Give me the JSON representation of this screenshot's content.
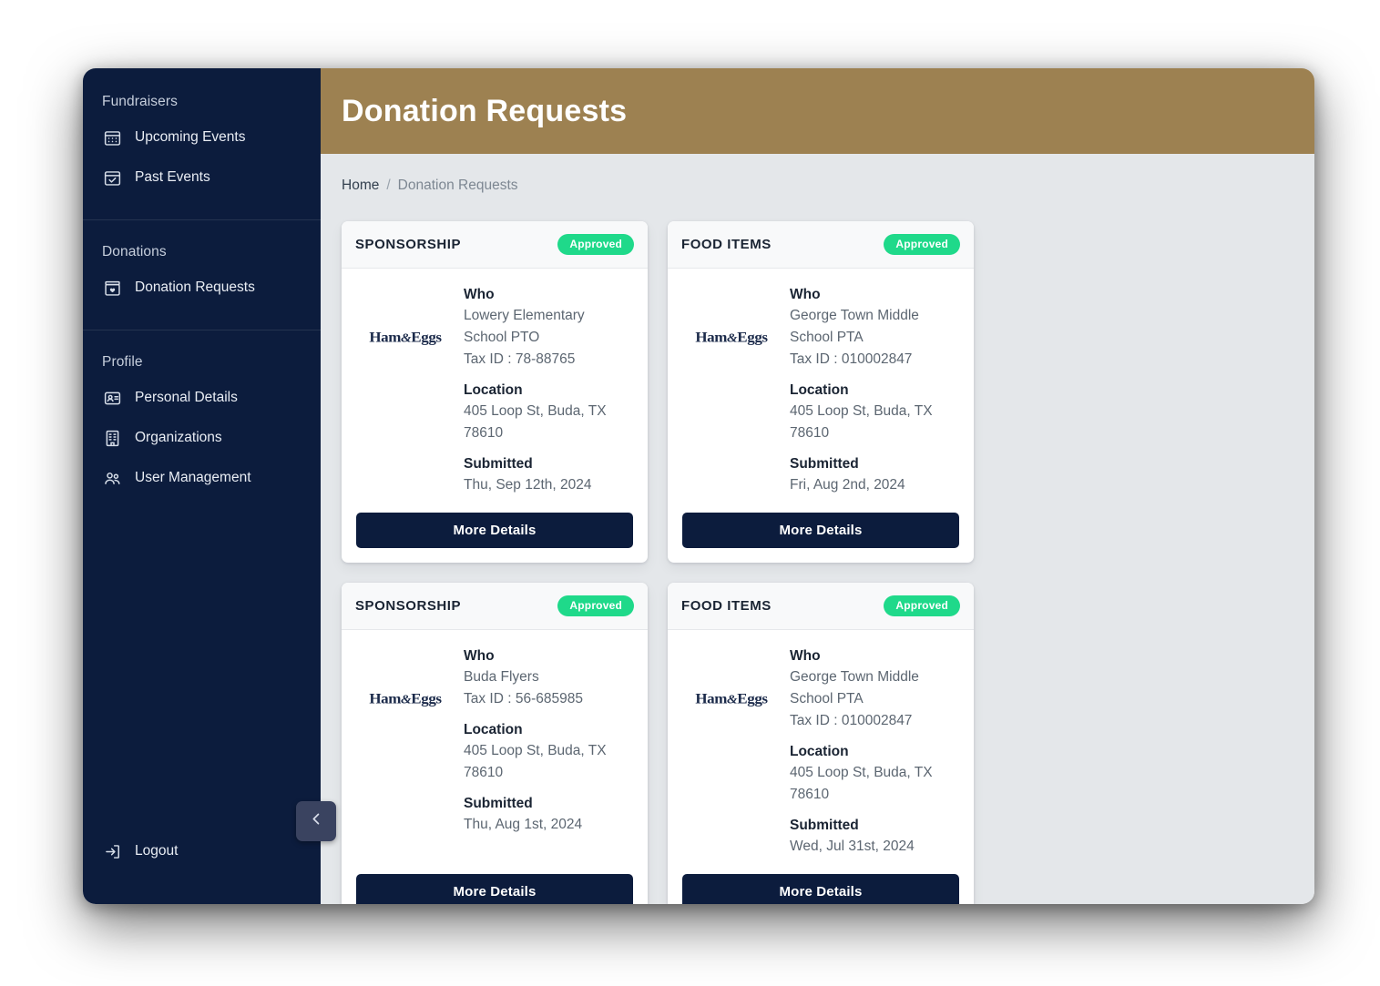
{
  "window": {
    "background": "#ffffff"
  },
  "colors": {
    "sidebar_bg": "#0C1C3D",
    "header_gold": "#9D8151",
    "content_bg": "#E4E7EA",
    "badge_green": "#1FD98A",
    "button_navy": "#0C1C3D"
  },
  "sidebar": {
    "sections": [
      {
        "title": "Fundraisers",
        "items": [
          {
            "label": "Upcoming Events",
            "icon": "calendar-dots-icon"
          },
          {
            "label": "Past Events",
            "icon": "calendar-check-icon"
          }
        ]
      },
      {
        "title": "Donations",
        "items": [
          {
            "label": "Donation Requests",
            "icon": "donation-box-heart-icon"
          }
        ]
      },
      {
        "title": "Profile",
        "items": [
          {
            "label": "Personal Details",
            "icon": "id-card-icon"
          },
          {
            "label": "Organizations",
            "icon": "building-icon"
          },
          {
            "label": "User Management",
            "icon": "users-icon"
          }
        ]
      }
    ],
    "logout": {
      "label": "Logout",
      "icon": "logout-arrow-icon"
    },
    "collapse_toggle": {
      "icon": "chevron-left-icon"
    }
  },
  "header": {
    "title": "Donation Requests"
  },
  "breadcrumb": {
    "home": "Home",
    "separator": "/",
    "current": "Donation Requests"
  },
  "card_common": {
    "who_label": "Who",
    "location_label": "Location",
    "submitted_label": "Submitted",
    "more_details_label": "More Details",
    "logo_text": "Ham&Eggs",
    "logo_left": "Ham",
    "logo_amp": "&",
    "logo_right": "Eggs"
  },
  "cards": [
    {
      "kind": "SPONSORSHIP",
      "status": "Approved",
      "org_line1": "Lowery Elementary",
      "org_line2": "School PTO",
      "tax_id": "Tax ID : 78-88765",
      "location_line1": "405 Loop St, Buda, TX",
      "location_line2": "78610",
      "submitted": "Thu, Sep 12th, 2024",
      "more_details_label": "More Details"
    },
    {
      "kind": "FOOD ITEMS",
      "status": "Approved",
      "org_line1": "George Town Middle",
      "org_line2": "School PTA",
      "tax_id": "Tax ID : 010002847",
      "location_line1": "405 Loop St, Buda, TX",
      "location_line2": "78610",
      "submitted": "Fri, Aug 2nd, 2024",
      "more_details_label": "More Details"
    },
    {
      "kind": "SPONSORSHIP",
      "status": "Approved",
      "org_line1": "Buda Flyers",
      "org_line2": "",
      "tax_id": "Tax ID : 56-685985",
      "location_line1": "405 Loop St, Buda, TX",
      "location_line2": "78610",
      "submitted": "Thu, Aug 1st, 2024",
      "more_details_label": "More Details"
    },
    {
      "kind": "FOOD ITEMS",
      "status": "Approved",
      "org_line1": "George Town Middle",
      "org_line2": "School PTA",
      "tax_id": "Tax ID : 010002847",
      "location_line1": "405 Loop St, Buda, TX",
      "location_line2": "78610",
      "submitted": "Wed, Jul 31st, 2024",
      "more_details_label": "More Details"
    }
  ]
}
